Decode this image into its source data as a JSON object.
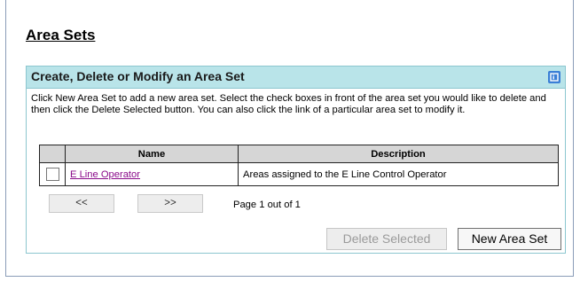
{
  "page": {
    "title": "Area Sets"
  },
  "panel": {
    "title": "Create, Delete or Modify an Area Set",
    "description": "Click New Area Set to add a new area set. Select the check boxes in front of the area set you would like to delete and then click the Delete Selected button. You can also click the link of a particular area set to modify it.",
    "help_icon": "help-icon"
  },
  "table": {
    "columns": [
      "",
      "Name",
      "Description"
    ],
    "rows": [
      {
        "checked": false,
        "name": "E Line Operator",
        "description": "Areas assigned to the E Line Control Operator"
      }
    ]
  },
  "pager": {
    "prev_label": "<<",
    "next_label": ">>",
    "page_info": "Page 1 out of 1"
  },
  "actions": {
    "delete_label": "Delete Selected",
    "delete_enabled": false,
    "new_label": "New Area Set"
  },
  "colors": {
    "panel_header_bg": "#b9e4e9",
    "panel_border": "#8cc6cf",
    "link": "#8a0b8a",
    "help_icon": "#3a7fd6"
  }
}
